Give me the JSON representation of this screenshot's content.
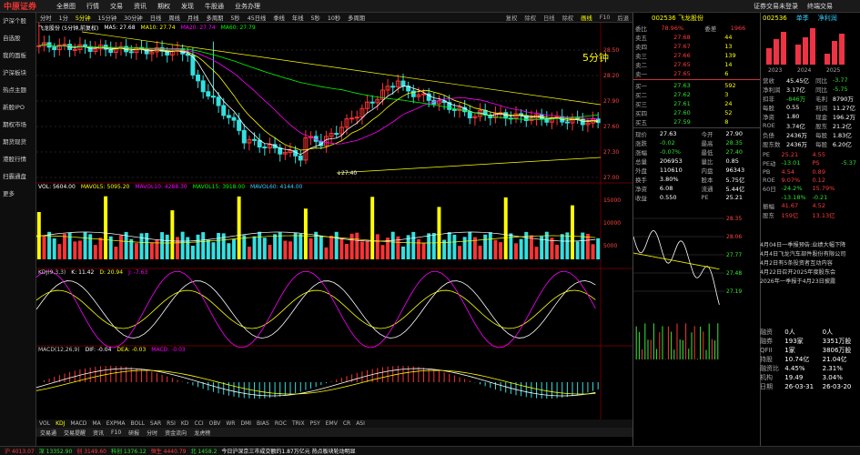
{
  "app": {
    "logo": "中原证券",
    "menu": [
      "全景图",
      "行情",
      "交易",
      "资讯",
      "期权",
      "发现",
      "牛股通",
      "业务办理"
    ],
    "right": [
      "证券交易未登录",
      "终端交易"
    ]
  },
  "sidebar": [
    "沪深个股",
    "自选股",
    "我的面板",
    "沪深板块",
    "热点主题",
    "新股IPO",
    "期权市场",
    "期货现货",
    "港股行情",
    "扫霸通盘",
    "更多"
  ],
  "periodbar": {
    "items": [
      "分时",
      "1分",
      "5分钟",
      "15分钟",
      "30分钟",
      "日线",
      "周线",
      "月线",
      "多周期",
      "5秒",
      "45日线",
      "季线",
      "年线",
      "5秒",
      "10秒",
      "多周期"
    ],
    "active": "5分钟",
    "tools": [
      "复权",
      "除权",
      "日线",
      "除权",
      "画线",
      "F10",
      "后退"
    ],
    "on_tool": "画线"
  },
  "chart_title": {
    "name": "飞龙股份 (5分钟,前复权)",
    "mas": [
      "MA5: 27.68",
      "MA10: 27.74",
      "MA20: 27.74",
      "MA60: 27.79"
    ],
    "label": "5分钟",
    "low_label": "↓27.40"
  },
  "price_axis": [
    "28.50",
    "28.20",
    "27.90",
    "27.60",
    "27.30",
    "27.00"
  ],
  "vol_legend": {
    "items": [
      "VOL: 5604.00",
      "MAVOL5: 5095.20",
      "MAVOL10: 4288.30",
      "MAVOL15: 3918.00",
      "MAVOL60: 4144.00"
    ],
    "axis": [
      "15000",
      "10000",
      "5000"
    ]
  },
  "kdj_legend": {
    "items": [
      "KDJ(9,3,3)",
      "K: 11.42",
      "D: 20.94",
      "J: -7.63"
    ]
  },
  "macd_legend": {
    "items": [
      "MACD(12,26,9)",
      "DIF: -0.04",
      "DEA: -0.03",
      "MACD: -0.03"
    ]
  },
  "indicators": [
    "VOL",
    "KDJ",
    "MACD",
    "MA",
    "EXPMA",
    "BOLL",
    "SAR",
    "RSI",
    "KD",
    "CCI",
    "OBV",
    "WR",
    "DMI",
    "BIAS",
    "ROC",
    "TRIX",
    "PSY",
    "EMV",
    "CR",
    "ASI"
  ],
  "indicator_on": "KDJ",
  "tabs": [
    "交易通",
    "交易提醒",
    "资讯",
    "F10",
    "研报",
    "分时",
    "资金流向",
    "龙虎榜"
  ],
  "quote": {
    "code": "002536",
    "name": "飞龙股份",
    "wb": "78.96%",
    "wc": "1966",
    "asks": [
      [
        "卖五",
        "27.68",
        "44"
      ],
      [
        "卖四",
        "27.67",
        "13"
      ],
      [
        "卖三",
        "27.66",
        "139"
      ],
      [
        "卖二",
        "27.65",
        "14"
      ],
      [
        "卖一",
        "27.65",
        "6"
      ]
    ],
    "bids": [
      [
        "买一",
        "27.63",
        "592"
      ],
      [
        "买二",
        "27.62",
        "3"
      ],
      [
        "买三",
        "27.61",
        "24"
      ],
      [
        "买四",
        "27.60",
        "52"
      ],
      [
        "买五",
        "27.59",
        "8"
      ]
    ],
    "stats": [
      [
        "现价",
        "27.63",
        "今开",
        "27.90"
      ],
      [
        "涨跌",
        "-0.02",
        "最高",
        "28.35"
      ],
      [
        "涨幅",
        "-0.07%",
        "最低",
        "27.40"
      ],
      [
        "总量",
        "206953",
        "量比",
        "0.85"
      ],
      [
        "外盘",
        "110610",
        "内盘",
        "96343"
      ],
      [
        "换手",
        "3.80%",
        "股本",
        "5.75亿"
      ],
      [
        "净资",
        "6.08",
        "流通",
        "5.44亿"
      ],
      [
        "收益",
        "0.550",
        "PE",
        "25.21"
      ]
    ]
  },
  "fs_axis": [
    "28.35",
    "28.06",
    "27.77",
    "27.48",
    "27.19"
  ],
  "finance": {
    "code": "002536",
    "tabs": [
      "单季",
      "净利润"
    ],
    "bars": [
      "2023",
      "2024",
      "2025"
    ],
    "rows": [
      [
        "营收",
        "45.45亿",
        "同比",
        "-3.77"
      ],
      [
        "净利润",
        "3.17亿",
        "同比",
        "-5.75"
      ],
      [
        "扣非",
        "-846万",
        "毛利",
        "8790万"
      ],
      [
        "每股",
        "0.55",
        "利润",
        "11.27亿"
      ],
      [
        "净资",
        "1.80",
        "现金",
        "196.2万"
      ],
      [
        "ROE",
        "3.74亿",
        "股东",
        "21.2亿"
      ],
      [
        "负债",
        "2436万",
        "每股",
        "1.83亿"
      ],
      [
        "股东数",
        "2436万",
        "每股",
        "6.20亿"
      ]
    ],
    "extra": [
      [
        "PE",
        "25.21",
        "4.55"
      ],
      [
        "PE动",
        "-13.01",
        "PS",
        "-5.37"
      ],
      [
        "PB",
        "4.54",
        "0.89"
      ],
      [
        "ROE",
        "9.07%",
        "0.12"
      ],
      [
        "60日",
        "-24.2%",
        "15.79%"
      ],
      [
        "",
        "-13.18%",
        "-0.21"
      ],
      [
        "振幅",
        "41.67",
        "4.52"
      ],
      [
        "股东",
        "159亿",
        "13.13亿"
      ]
    ],
    "news_title": "4月04日一季报预告:业绩大幅下降",
    "news": [
      "4月4日飞龙汽车部件股份有限公司",
      "4月2日有5条投资者互动内容",
      "4月22日召开2025年度股东会",
      "2026年一季报于4月23日披露"
    ],
    "bottom": [
      [
        "融资",
        "0人",
        "0人"
      ],
      [
        "融券",
        "193家",
        "3351万股"
      ],
      [
        "QFII",
        "1家",
        "3806万股"
      ],
      [
        "持股",
        "10.74亿",
        "21.04亿"
      ],
      [
        "融资比",
        "4.45%",
        "2.31%"
      ],
      [
        "机构",
        "19.49",
        "3.04%"
      ],
      [
        "日期",
        "26-03-31",
        "26-03-20"
      ]
    ]
  },
  "status": {
    "items": [
      "沪 4013.07",
      "深 13352.90",
      "创 3149.60",
      "科创 1376.12",
      "恒生 4440.79",
      "北 1458.2"
    ],
    "news": "今日沪深京三市成交额约1.87万亿元 热点板块轮动明显"
  }
}
